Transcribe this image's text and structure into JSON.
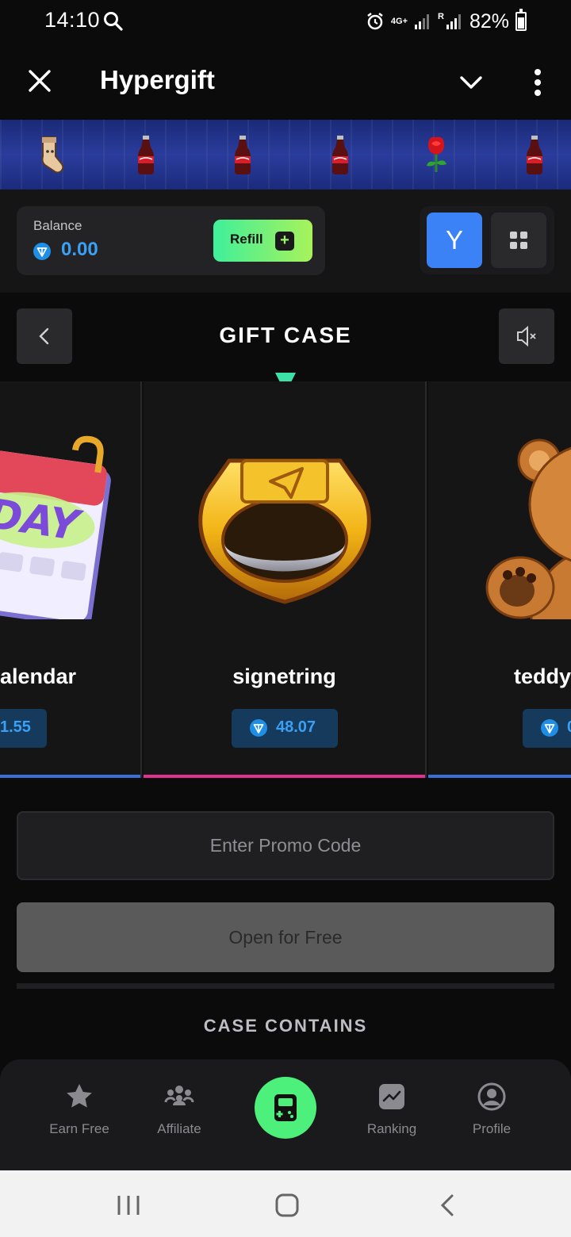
{
  "status_bar": {
    "time": "14:10",
    "network": "4G+",
    "roaming": "R",
    "battery": "82%"
  },
  "header": {
    "title": "Hypergift"
  },
  "ticker": {
    "items": [
      "sock-icon",
      "cola-bottle-icon",
      "cola-bottle-icon",
      "cola-bottle-icon",
      "rose-icon",
      "cola-bottle-icon"
    ]
  },
  "balance": {
    "label": "Balance",
    "value": "0.00",
    "refill_label": "Refill",
    "mode_label": "Y"
  },
  "case": {
    "title": "GIFT CASE",
    "items": [
      {
        "name": "alendar",
        "price": "1.55",
        "bar_color": "#3b6fd8"
      },
      {
        "name": "signetring",
        "price": "48.07",
        "bar_color": "#e0338f"
      },
      {
        "name": "teddy",
        "price": "0",
        "bar_color": "#3b6fd8"
      }
    ]
  },
  "promo": {
    "placeholder": "Enter Promo Code"
  },
  "open_button": "Open for Free",
  "contains_title": "CASE CONTAINS",
  "bottom_nav": {
    "items": [
      {
        "label": "Earn Free"
      },
      {
        "label": "Affiliate"
      },
      {
        "label": "Ranking"
      },
      {
        "label": "Profile"
      }
    ]
  },
  "colors": {
    "accent_green": "#4cf07a",
    "ton_blue": "#3aa0f5",
    "mode_blue": "#3b82f6",
    "pointer": "#3de0a6"
  }
}
